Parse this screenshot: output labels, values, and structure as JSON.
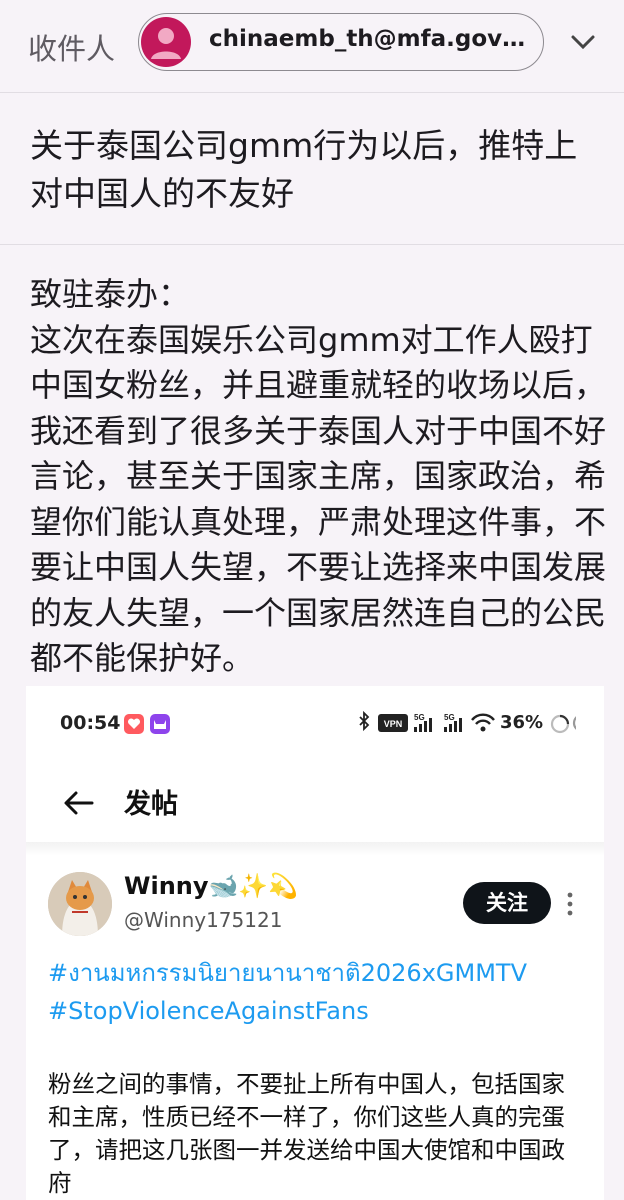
{
  "compose": {
    "to_label": "收件人",
    "recipient": "chinaemb_th@mfa.gov…",
    "subject": "关于泰国公司gmm行为以后，推特上对中国人的不友好",
    "body": "致驻泰办：\n这次在泰国娱乐公司gmm对工作人殴打中国女粉丝，并且避重就轻的收场以后，我还看到了很多关于泰国人对于中国不好言论，甚至关于国家主席，国家政治，希望你们能认真处理，严肃处理这件事，不要让中国人失望，不要让选择来中国发展的友人失望，一个国家居然连自己的公民都不能保护好。"
  },
  "screenshot": {
    "status_bar": {
      "time": "00:54",
      "battery": "36%",
      "icons": [
        "heart-app-icon",
        "cat-app-icon",
        "bluetooth-icon",
        "vpn-icon",
        "signal-5g-icon",
        "signal-5g-icon",
        "wifi-icon",
        "loading-icon"
      ]
    },
    "header": {
      "title": "发帖"
    },
    "tweet": {
      "name": "Winny🐋✨💫",
      "handle": "@Winny175121",
      "follow_label": "关注",
      "tags": "#งานมหกรรมนิยายนานาชาติ2026xGMMTV #StopViolenceAgainstFans",
      "text": "粉丝之间的事情，不要扯上所有中国人，包括国家和主席，性质已经不一样了，你们这些人真的完蛋了，请把这几张图一并发送给中国大使馆和中国政府"
    }
  }
}
